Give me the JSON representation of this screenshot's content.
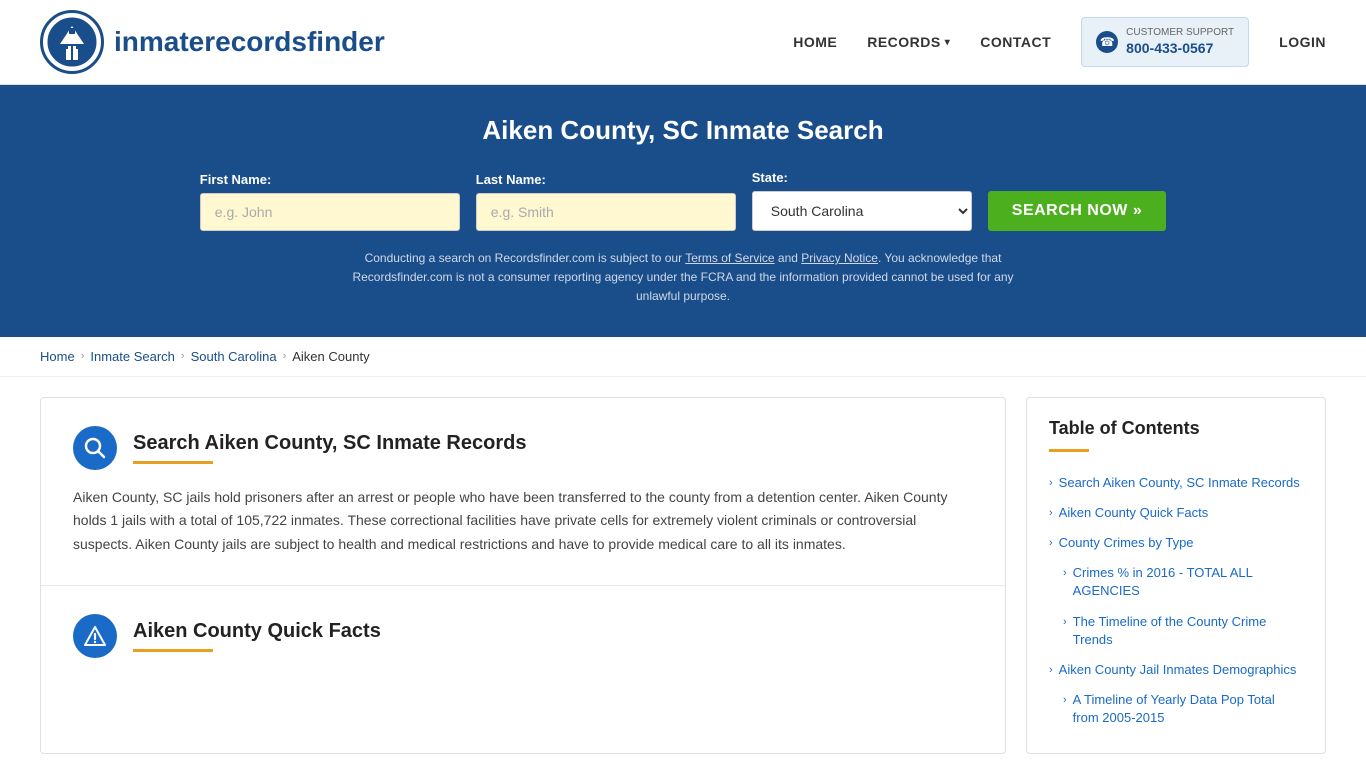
{
  "header": {
    "logo_text_plain": "inmaterecords",
    "logo_text_bold": "finder",
    "nav": {
      "home": "HOME",
      "records": "RECORDS",
      "contact": "CONTACT",
      "support_label": "CUSTOMER SUPPORT",
      "support_number": "800-433-0567",
      "login": "LOGIN"
    }
  },
  "banner": {
    "title": "Aiken County, SC Inmate Search",
    "first_name_label": "First Name:",
    "first_name_placeholder": "e.g. John",
    "last_name_label": "Last Name:",
    "last_name_placeholder": "e.g. Smith",
    "state_label": "State:",
    "state_value": "South Carolina",
    "search_button": "SEARCH NOW »",
    "disclaimer": "Conducting a search on Recordsfinder.com is subject to our Terms of Service and Privacy Notice. You acknowledge that Recordsfinder.com is not a consumer reporting agency under the FCRA and the information provided cannot be used for any unlawful purpose.",
    "tos_link": "Terms of Service",
    "privacy_link": "Privacy Notice"
  },
  "breadcrumb": {
    "items": [
      "Home",
      "Inmate Search",
      "South Carolina",
      "Aiken County"
    ]
  },
  "main": {
    "section1": {
      "title": "Search Aiken County, SC Inmate Records",
      "body": "Aiken County, SC jails hold prisoners after an arrest or people who have been transferred to the county from a detention center. Aiken County holds 1 jails with a total of 105,722 inmates. These correctional facilities have private cells for extremely violent criminals or controversial suspects. Aiken County jails are subject to health and medical restrictions and have to provide medical care to all its inmates."
    },
    "section2": {
      "title": "Aiken County Quick Facts"
    }
  },
  "toc": {
    "title": "Table of Contents",
    "items": [
      {
        "label": "Search Aiken County, SC Inmate Records",
        "indent": false
      },
      {
        "label": "Aiken County Quick Facts",
        "indent": false
      },
      {
        "label": "County Crimes by Type",
        "indent": false
      },
      {
        "label": "Crimes % in 2016 - TOTAL ALL AGENCIES",
        "indent": true
      },
      {
        "label": "The Timeline of the County Crime Trends",
        "indent": true
      },
      {
        "label": "Aiken County Jail Inmates Demographics",
        "indent": false
      },
      {
        "label": "A Timeline of Yearly Data Pop Total from 2005-2015",
        "indent": true
      }
    ]
  }
}
